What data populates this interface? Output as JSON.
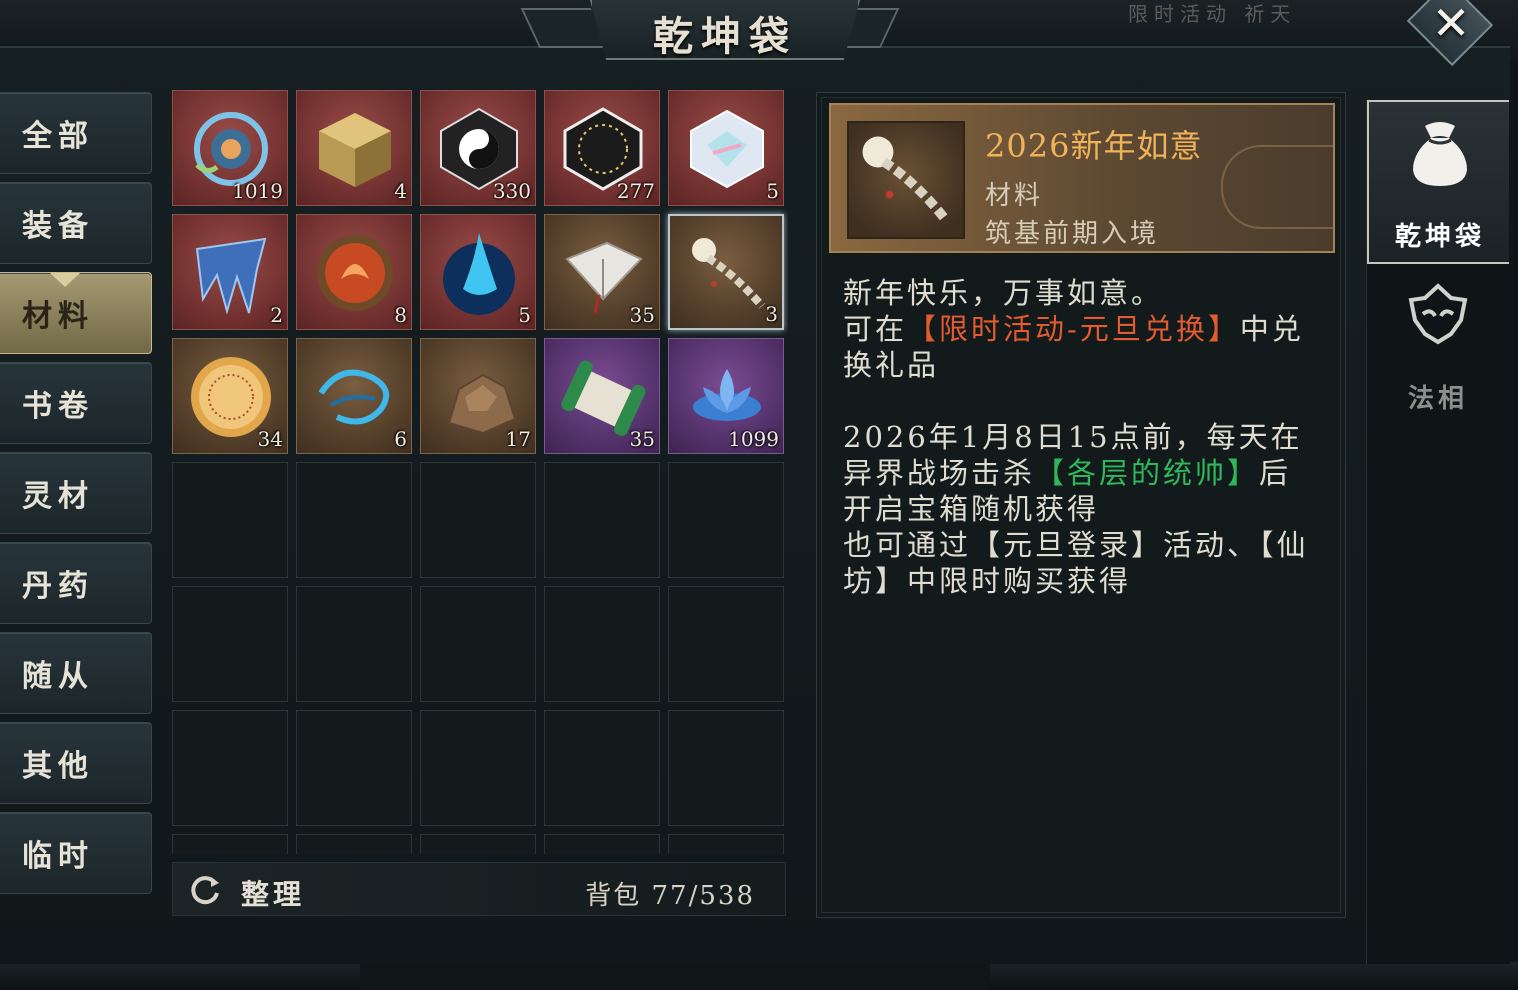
{
  "window": {
    "title": "乾坤袋",
    "close_label": "✕"
  },
  "background": {
    "top_text": "限时活动 祈天"
  },
  "categories": [
    {
      "label": "全部",
      "active": false
    },
    {
      "label": "装备",
      "active": false
    },
    {
      "label": "材料",
      "active": true
    },
    {
      "label": "书卷",
      "active": false
    },
    {
      "label": "灵材",
      "active": false
    },
    {
      "label": "丹药",
      "active": false
    },
    {
      "label": "随从",
      "active": false
    },
    {
      "label": "其他",
      "active": false
    },
    {
      "label": "临时",
      "active": false
    }
  ],
  "inventory": {
    "items": [
      {
        "icon": "swirl-orb-icon",
        "count": "1019",
        "rarity": "red"
      },
      {
        "icon": "gold-cube-icon",
        "count": "4",
        "rarity": "red"
      },
      {
        "icon": "yin-yang-stone-icon",
        "count": "330",
        "rarity": "red"
      },
      {
        "icon": "star-chart-stone-icon",
        "count": "277",
        "rarity": "red"
      },
      {
        "icon": "prism-crystal-icon",
        "count": "5",
        "rarity": "red"
      },
      {
        "icon": "ice-crystal-icon",
        "count": "2",
        "rarity": "red"
      },
      {
        "icon": "fire-orb-icon",
        "count": "8",
        "rarity": "red"
      },
      {
        "icon": "blue-flame-orb-icon",
        "count": "5",
        "rarity": "red"
      },
      {
        "icon": "book-scroll-icon",
        "count": "35",
        "rarity": "brown"
      },
      {
        "icon": "ruyi-scepter-icon",
        "count": "3",
        "rarity": "brown",
        "selected": true
      },
      {
        "icon": "golden-coin-icon",
        "count": "34",
        "rarity": "brown"
      },
      {
        "icon": "water-swirl-icon",
        "count": "6",
        "rarity": "brown"
      },
      {
        "icon": "ore-rock-icon",
        "count": "17",
        "rarity": "brown"
      },
      {
        "icon": "jade-scroll-icon",
        "count": "35",
        "rarity": "purple"
      },
      {
        "icon": "lotus-flower-icon",
        "count": "1099",
        "rarity": "purple"
      }
    ],
    "sort_label": "整理",
    "bag_label": "背包 77/538"
  },
  "detail": {
    "name": "2026新年如意",
    "type": "材料",
    "level": "筑基前期入境",
    "desc_line1": "新年快乐，万事如意。",
    "desc_line2_a": "可在",
    "desc_line2_hl": "【限时活动-元旦兑换】",
    "desc_line2_b": "中兑换礼品",
    "desc_line3_a": "2026年1月8日15点前，每天在异界战场击杀",
    "desc_line3_hl": "【各层的统帅】",
    "desc_line3_b": "后开启宝箱随机获得",
    "desc_line4": "也可通过【元旦登录】活动、【仙坊】中限时购买获得"
  },
  "side_tabs": [
    {
      "label": "乾坤袋",
      "icon": "pouch-icon",
      "active": true
    },
    {
      "label": "法相",
      "icon": "dharma-mask-icon",
      "active": false
    }
  ],
  "colors": {
    "accent_gold": "#f0b35a",
    "highlight_red": "#e45b2e",
    "highlight_green": "#2fb85a"
  }
}
